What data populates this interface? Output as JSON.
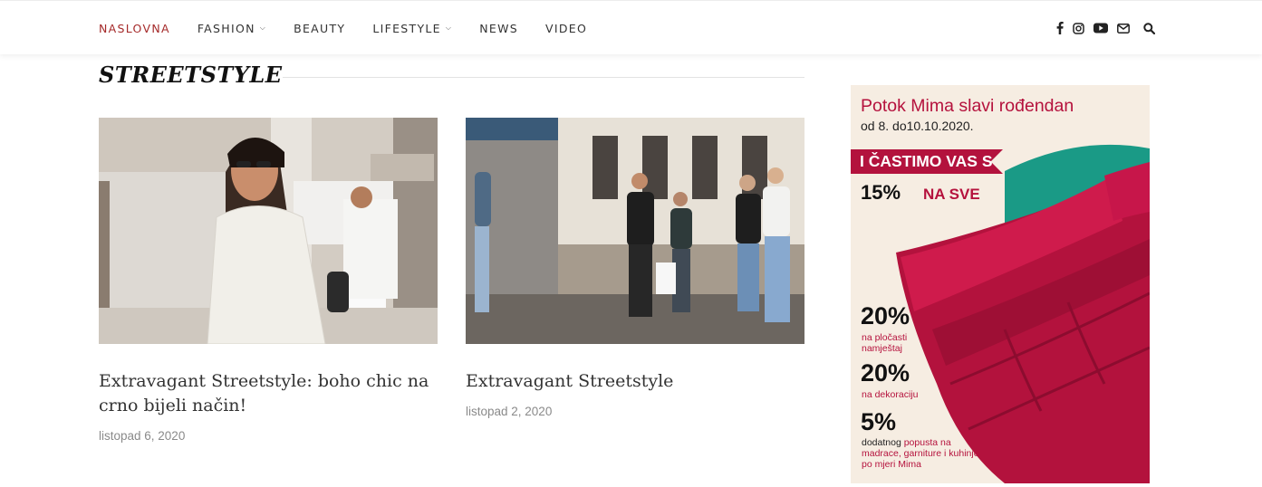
{
  "nav": {
    "items": [
      {
        "label": "NASLOVNA",
        "active": true,
        "dropdown": false
      },
      {
        "label": "FASHION",
        "active": false,
        "dropdown": true
      },
      {
        "label": "BEAUTY",
        "active": false,
        "dropdown": false
      },
      {
        "label": "LIFESTYLE",
        "active": false,
        "dropdown": true
      },
      {
        "label": "NEWS",
        "active": false,
        "dropdown": false
      },
      {
        "label": "VIDEO",
        "active": false,
        "dropdown": false
      }
    ],
    "social_icons": [
      "facebook-icon",
      "instagram-icon",
      "youtube-icon",
      "envelope-icon"
    ],
    "search_icon": "search-icon"
  },
  "section": {
    "title": "STREETSTYLE"
  },
  "posts": [
    {
      "title": "Extravagant Streetstyle: boho chic na crno bijeli način!",
      "date": "listopad 6, 2020"
    },
    {
      "title": "Extravagant Streetstyle",
      "date": "listopad 2, 2020"
    }
  ],
  "ad": {
    "headline": "Potok Mima slavi rođendan",
    "dates": "od 8. do10.10.2020.",
    "banner": "I ČASTIMO VAS S",
    "main_percent": "15%",
    "main_suffix": "NA SVE",
    "offer1_percent": "20%",
    "offer1_text": "na pločasti namještaj",
    "offer2_percent": "20%",
    "offer2_text": "na dekoraciju",
    "offer3_percent": "5%",
    "offer3_text_dark": "dodatnog",
    "offer3_text": "popusta na madrace, garniture i kuhinje po mjeri Mima"
  },
  "colors": {
    "accent_active_nav": "#a52a2a",
    "ad_red": "#b5123d",
    "ad_teal": "#1a9a86",
    "ad_cream": "#f6ede2"
  }
}
